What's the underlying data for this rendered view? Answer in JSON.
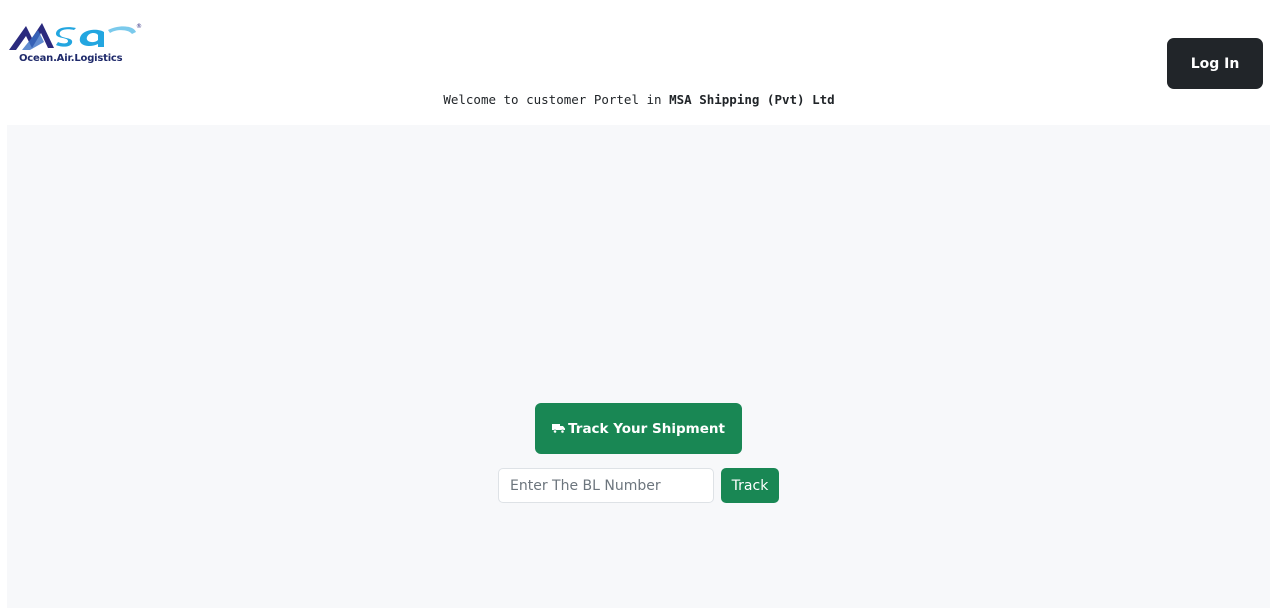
{
  "brand": {
    "logo_text": "msa",
    "tagline": "Ocean.Air.Logistics",
    "registered_mark": "®",
    "colors": {
      "navy": "#2b2a7e",
      "cyan": "#23a6e0"
    }
  },
  "header": {
    "login_label": "Log In",
    "welcome_prefix": "Welcome to customer Portel in ",
    "welcome_company": "MSA Shipping (Pvt) Ltd"
  },
  "tracking": {
    "title_button_label": "Track Your Shipment",
    "title_icon": "truck-icon",
    "bl_input_placeholder": "Enter The BL Number",
    "bl_input_value": "",
    "track_button_label": "Track"
  },
  "colors": {
    "primary_dark": "#212529",
    "success": "#198754",
    "panel_bg": "#f7f8fa"
  }
}
